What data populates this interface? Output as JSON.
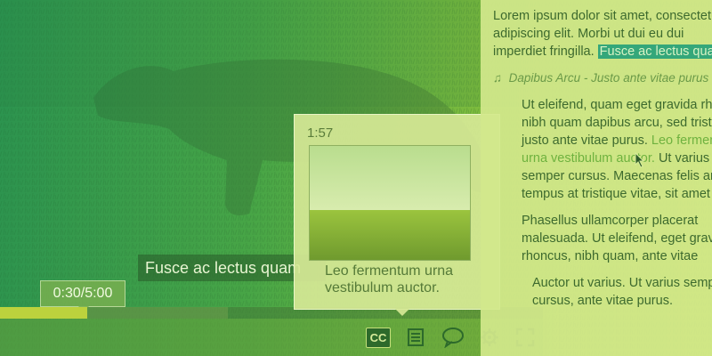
{
  "player": {
    "caption": "Fusce ac lectus quam",
    "current_time": "0:30/5:00",
    "progress": {
      "played_fraction": 0.16,
      "buffered_fraction": 0.42
    },
    "controls": [
      {
        "name": "captions-button",
        "label": "CC",
        "icon": "cc-icon"
      },
      {
        "name": "transcript-button",
        "icon": "transcript-icon"
      },
      {
        "name": "chat-button",
        "icon": "speech-bubble-icon"
      },
      {
        "name": "settings-button",
        "icon": "gear-icon"
      },
      {
        "name": "fullscreen-button",
        "icon": "fullscreen-icon"
      }
    ]
  },
  "preview": {
    "time": "1:57",
    "text_line1": "Leo fermentum urna",
    "text_line2": "vestibulum auctor."
  },
  "transcript": {
    "para1_line1": "Lorem ipsum dolor sit amet, consectetur",
    "para1_line2": "adipiscing elit. Morbi ut dui eu dui",
    "para1_line3_pre": "imperdiet fringilla. ",
    "para1_line3_hl": "Fusce ac lectus quam",
    "chapter_icon": "music-note-icon",
    "chapter": "Dapibus Arcu - Justo ante vitae purus",
    "para2_line1": "Ut eleifend, quam eget gravida rhoncus,",
    "para2_line2": "nibh quam dapibus arcu, sed tristique",
    "para2_line3_pre": "justo ante vitae purus. ",
    "para2_line3_link": "Leo fermentum",
    "para2_line4_link": "urna vestibulum auctor.",
    "para2_line4_post": " Ut varius",
    "para2_line5": "semper cursus. Maecenas felis ante,",
    "para2_line6": "tempus at tristique vitae, sit amet",
    "para3_line1": "Phasellus ullamcorper placerat",
    "para3_line2": "malesuada. Ut eleifend, eget gravida",
    "para3_line3": "rhoncus, nibh quam, ante vitae",
    "para4_line1": "Auctor ut varius. Ut varius semper",
    "para4_line2": "cursus, ante vitae purus."
  },
  "colors": {
    "accent": "#bcd23d",
    "highlight": "#34a77a",
    "link": "#6fb23f"
  }
}
